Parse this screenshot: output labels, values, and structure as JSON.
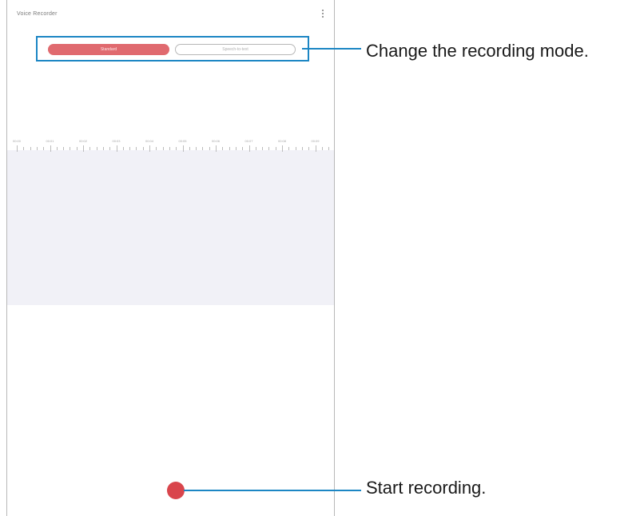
{
  "app": {
    "title": "Voice Recorder",
    "more_icon": "more-vertical-icon"
  },
  "mode_tabs": [
    {
      "label": "Standard",
      "selected": true
    },
    {
      "label": "Speech-to-text",
      "selected": false
    }
  ],
  "timeline": {
    "tick_labels": [
      "00:00",
      "00:01",
      "00:02",
      "00:03",
      "00:04",
      "00:05",
      "00:06",
      "00:07",
      "00:08",
      "00:09"
    ]
  },
  "record_button": {
    "icon": "record-dot-icon"
  },
  "callouts": {
    "mode": "Change the recording mode.",
    "record": "Start recording."
  },
  "colors": {
    "accent_red": "#d9454c",
    "tab_active": "#e06a6f",
    "callout_blue": "#1c86c4",
    "timeline_bg": "#f1f1f7"
  }
}
